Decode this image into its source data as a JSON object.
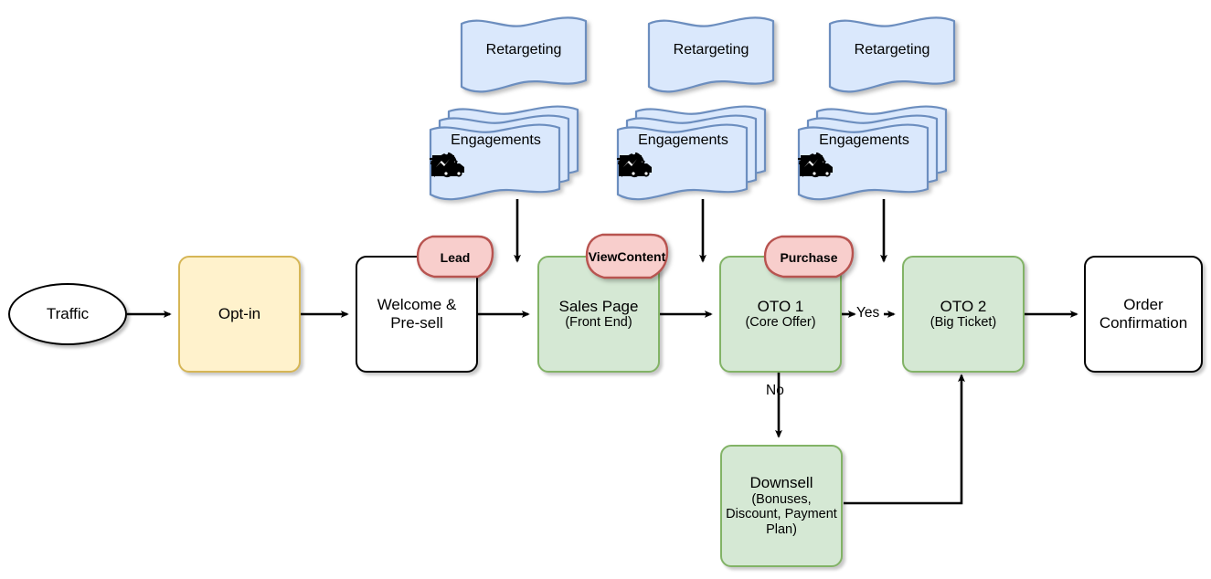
{
  "diagram": {
    "title": "Sales Funnel Flowchart",
    "colors": {
      "green_fill": "#d5e8d4",
      "green_stroke": "#82b366",
      "yellow_fill": "#fff2cc",
      "yellow_stroke": "#d6b656",
      "pink_fill": "#f8cecc",
      "pink_stroke": "#b85450",
      "blue_fill": "#dae8fc",
      "blue_stroke": "#6c8ebf",
      "white_fill": "#ffffff",
      "black_stroke": "#000000"
    }
  },
  "nodes": {
    "traffic": {
      "label": "Traffic"
    },
    "optin": {
      "label": "Opt-in"
    },
    "welcome": {
      "line1": "Welcome &",
      "line2": "Pre-sell"
    },
    "sales": {
      "line1": "Sales Page",
      "line2": "(Front End)"
    },
    "oto1": {
      "line1": "OTO 1",
      "line2": "(Core Offer)"
    },
    "oto2": {
      "line1": "OTO 2",
      "line2": "(Big Ticket)"
    },
    "order": {
      "line1": "Order",
      "line2": "Confirmation"
    },
    "downsell": {
      "line1": "Downsell",
      "line2": "(Bonuses,",
      "line3": "Discount, Payment",
      "line4": "Plan)"
    }
  },
  "badges": [
    {
      "id": "lead",
      "label": "Lead"
    },
    {
      "id": "view-content",
      "line1": "View",
      "line2": "Content"
    },
    {
      "id": "purchase",
      "label": "Purchase"
    }
  ],
  "retargeting_groups": [
    {
      "id": "group-1",
      "retargeting_label": "Retargeting",
      "engagements_label": "Engagements",
      "icons": [
        "email-at-icon",
        "phone-ringing-icon",
        "delivery-truck-icon",
        "messenger-chat-icon"
      ]
    },
    {
      "id": "group-2",
      "retargeting_label": "Retargeting",
      "engagements_label": "Engagements",
      "icons": [
        "email-at-icon",
        "phone-ringing-icon",
        "delivery-truck-icon",
        "messenger-chat-icon"
      ]
    },
    {
      "id": "group-3",
      "retargeting_label": "Retargeting",
      "engagements_label": "Engagements",
      "icons": [
        "email-at-icon",
        "phone-ringing-icon",
        "delivery-truck-icon",
        "messenger-chat-icon"
      ]
    }
  ],
  "edge_labels": {
    "yes": "Yes",
    "no": "No"
  }
}
